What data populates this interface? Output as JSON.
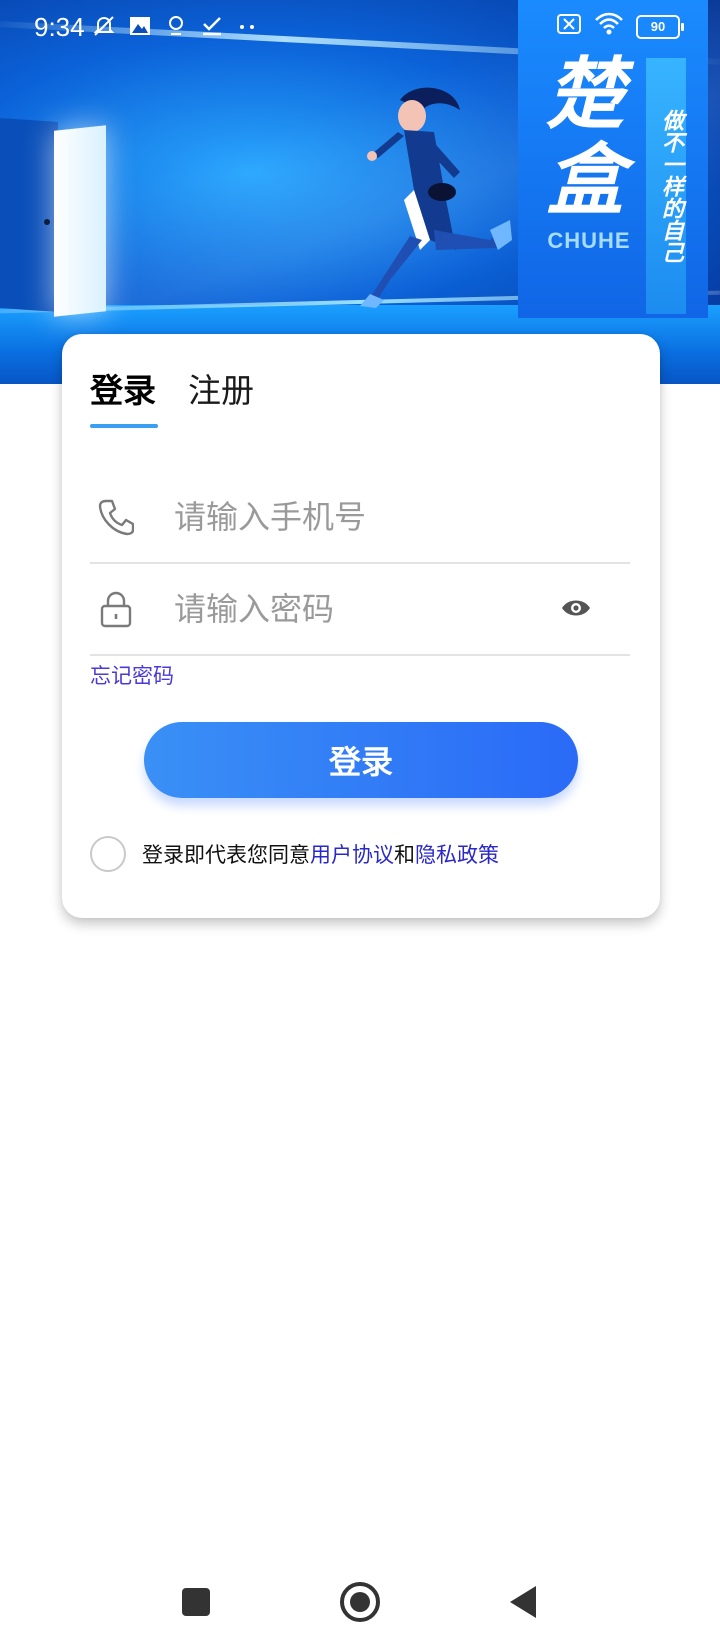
{
  "status_bar": {
    "time": "9:34",
    "battery": "90",
    "left_icons": [
      "mute-icon",
      "image-icon",
      "location-icon",
      "checkmark-icon",
      "more-dots-icon"
    ],
    "right_icons": [
      "sim-off-icon",
      "wifi-icon",
      "battery-icon"
    ]
  },
  "hero": {
    "brand_big": "楚盒",
    "brand_en": "CHUHE",
    "slogan": "做不一样的自己"
  },
  "login": {
    "tabs": [
      {
        "label": "登录",
        "active": true
      },
      {
        "label": "注册",
        "active": false
      }
    ],
    "phone_placeholder": "请输入手机号",
    "password_placeholder": "请输入密码",
    "forgot_label": "忘记密码",
    "submit_label": "登录",
    "agreement": {
      "prefix": "登录即代表您同意",
      "terms": "用户协议",
      "and": "和",
      "privacy": "隐私政策",
      "checked": false
    }
  },
  "colors": {
    "accent": "#3a9ff0",
    "button_start": "#3a90f6",
    "button_end": "#2a6af7",
    "link": "#2a28c8"
  },
  "nav_bar": {
    "buttons": [
      "recents-icon",
      "home-icon",
      "back-icon"
    ]
  }
}
